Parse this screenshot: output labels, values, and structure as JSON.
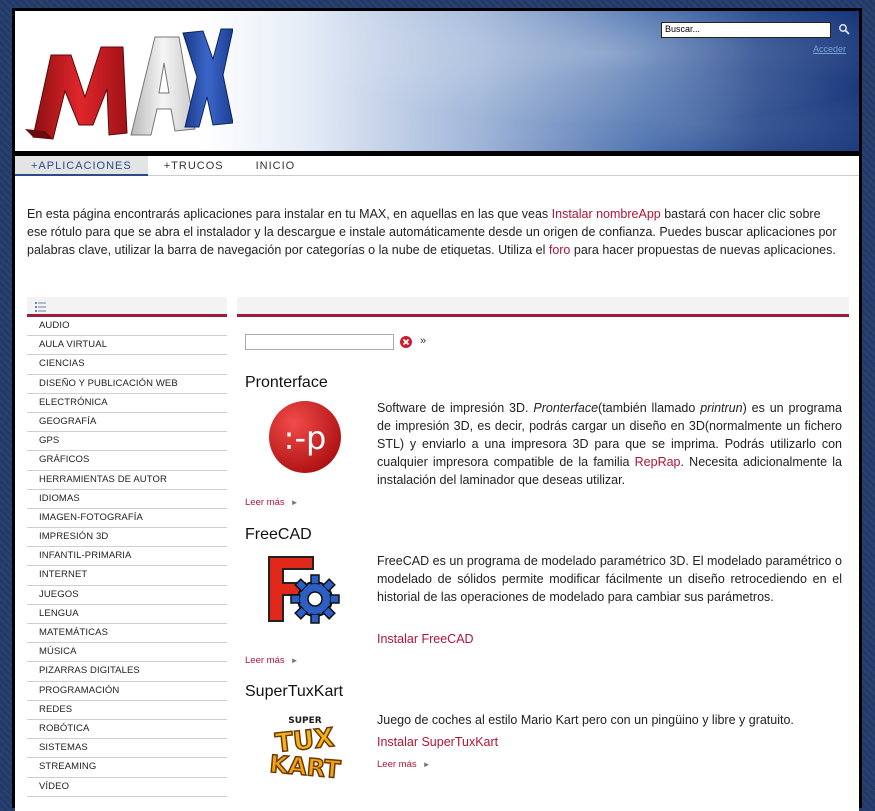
{
  "header": {
    "logo_text": "MAX",
    "search_value": "Buscar...",
    "access_link": "Acceder",
    "colors": {
      "frame": "#000000",
      "accent": "#9b1c3a",
      "link": "#b01535"
    }
  },
  "nav": {
    "items": [
      {
        "label": "+APLICACIONES",
        "active": true
      },
      {
        "label": "+TRUCOS",
        "active": false
      },
      {
        "label": "INICIO",
        "active": false
      }
    ]
  },
  "intro": {
    "text1": "En esta página encontrarás aplicaciones para instalar en tu MAX, en aquellas en las que veas ",
    "link1": "Instalar nombreApp",
    "text2": " bastará con hacer clic sobre ese rótulo para que se abra el instalador y la descargue e instale automáticamente desde un origen de confianza. Puedes buscar aplicaciones por palabras clave, utilizar la barra de navegación por categorías o la nube de etiquetas. Utiliza el ",
    "link2": "foro",
    "text3": " para hacer propuestas de nuevas aplicaciones."
  },
  "sidebar": {
    "items": [
      "AUDIO",
      "AULA VIRTUAL",
      "CIENCIAS",
      "DISEÑO Y PUBLICACIÓN WEB",
      "ELECTRÓNICA",
      "GEOGRAFÍA",
      "GPS",
      "GRÁFICOS",
      "HERRAMIENTAS DE AUTOR",
      "IDIOMAS",
      "IMAGEN-FOTOGRAFÍA",
      "IMPRESIÓN 3D",
      "INFANTIL-PRIMARIA",
      "INTERNET",
      "JUEGOS",
      "LENGUA",
      "MATEMÁTICAS",
      "MÚSICA",
      "PIZARRAS DIGITALES",
      "PROGRAMACIÓN",
      "REDES",
      "ROBÓTICA",
      "SISTEMAS",
      "STREAMING",
      "VÍDEO"
    ]
  },
  "main": {
    "filter_placeholder": "",
    "go_symbol": "»",
    "more_label": "Leer más",
    "apps": [
      {
        "title": "Pronterface",
        "logo_text": ":-p",
        "desc_a": "Software de impresión 3D. ",
        "desc_b": "Pronterface",
        "desc_c": "(también llamado ",
        "desc_d": "printrun",
        "desc_e": ") es un programa de impresión 3D, es decir, podrás cargar un diseño en 3D(normalmente un fichero STL) y enviarlo a una impresora 3D para que se imprima. Podrás utilizarlo con cualquier impresora compatible de la familia ",
        "desc_link": "RepRap",
        "desc_f": ". Necesita adicionalmente la instalación del laminador que deseas utilizar."
      },
      {
        "title": "FreeCAD",
        "desc": "FreeCAD es un programa de modelado paramétrico 3D. El modelado paramétrico o modelado de sólidos permite modificar fácilmente un diseño retrocediendo en el historial de las operaciones de modelado para cambiar sus parámetros.",
        "install": "Instalar FreeCAD"
      },
      {
        "title": "SuperTuxKart",
        "logo_top": "SUPER",
        "logo_mid": "TUX",
        "logo_bot": "KART",
        "desc": " Juego de coches al estilo Mario Kart pero con un pingüino y libre y gratuito.",
        "install": "Instalar SuperTuxKart"
      }
    ]
  }
}
